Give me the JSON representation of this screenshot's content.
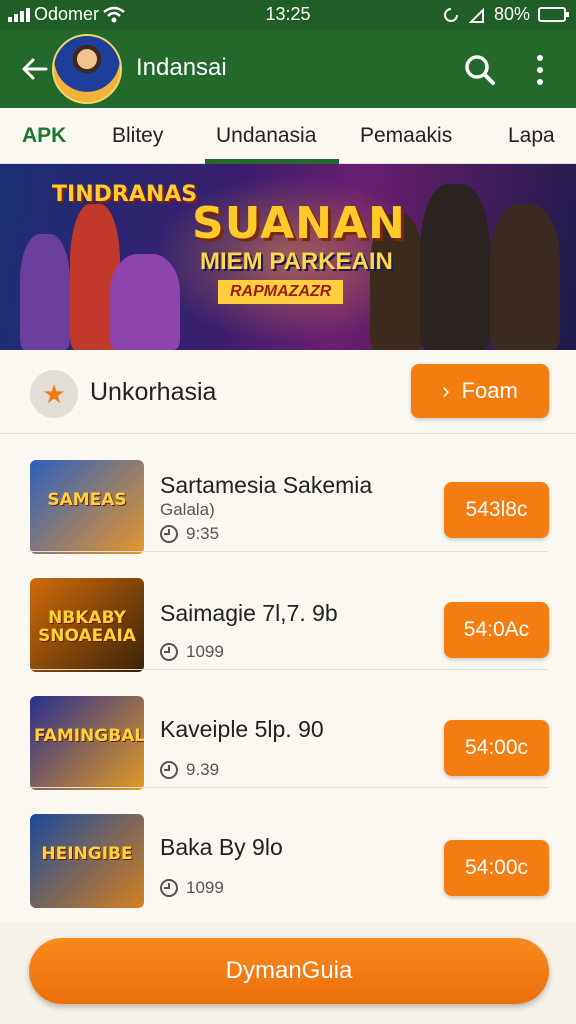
{
  "status_bar": {
    "carrier": "Odomer",
    "time": "13:25",
    "battery": "80%",
    "battery_level": 0.8
  },
  "app_bar": {
    "title": "Indansai",
    "back_icon": "arrow-left-icon",
    "search_icon": "search-icon",
    "more_icon": "more-vertical-icon"
  },
  "tabs": [
    {
      "label": "APK"
    },
    {
      "label": "Blitey"
    },
    {
      "label": "Undanasia"
    },
    {
      "label": "Pemaakis"
    },
    {
      "label": "Lapa"
    }
  ],
  "banner": {
    "logo": "TINDRANAS",
    "title": "SUANAN",
    "subtitle": "MIEM PARKEAIN",
    "tag": "RAPMAZAZR"
  },
  "section": {
    "title": "Unkorhasia",
    "icon": "star-icon",
    "button_label": "Foam",
    "button_icon": "chevron-right-icon"
  },
  "items": [
    {
      "title": "Sartamesia Sakemia",
      "subtitle": "Galala)",
      "meta": "9:35",
      "price": "543l8c",
      "thumb_text": "SAMEAS",
      "thumb_colors": [
        "#2c5fbf",
        "#e8962a"
      ]
    },
    {
      "title": "Saimagie 7l,7. 9b",
      "subtitle": "",
      "meta": "1099",
      "price": "54:0Ac",
      "thumb_text": "NBKABY SNOAEAIA",
      "thumb_colors": [
        "#d06b0a",
        "#3a2308"
      ]
    },
    {
      "title": "Kaveiple 5lp. 90",
      "subtitle": "",
      "meta": "9.39",
      "price": "54:00c",
      "thumb_text": "FAMINGBAL",
      "thumb_colors": [
        "#2a2f8f",
        "#e39a22"
      ]
    },
    {
      "title": "Baka By 9lo",
      "subtitle": "",
      "meta": "1099",
      "price": "54:00c",
      "thumb_text": "HEINGIBE",
      "thumb_colors": [
        "#1b4a9c",
        "#d4801e"
      ]
    }
  ],
  "bottom_button": {
    "label": "DymanGuia"
  },
  "colors": {
    "primary_green": "#23692b",
    "accent_orange": "#f47d12",
    "background": "#f6f2ea"
  }
}
